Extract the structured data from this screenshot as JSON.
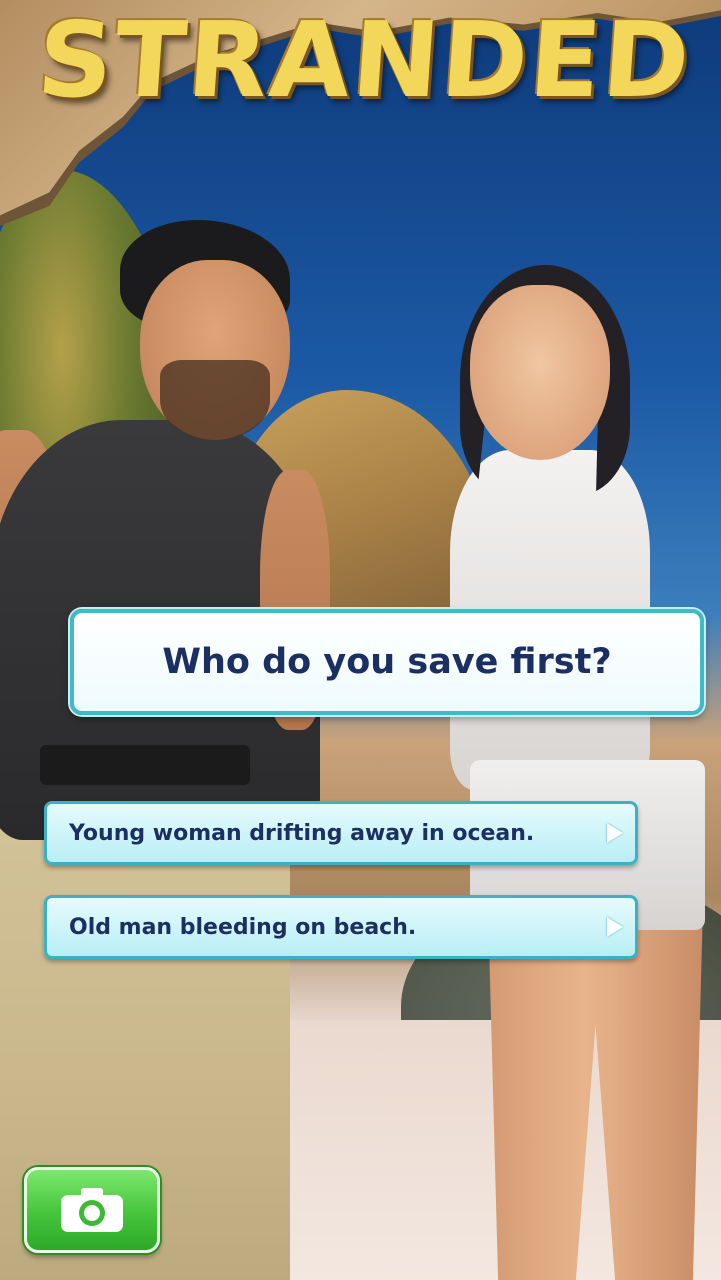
{
  "game": {
    "title": "STRANDED"
  },
  "dialog": {
    "question": "Who do you save first?",
    "choices": [
      {
        "label": "Young woman drifting away in ocean."
      },
      {
        "label": "Old man bleeding on beach."
      }
    ]
  },
  "controls": {
    "camera_icon": "camera-icon",
    "choice_arrow_icon": "play-arrow-icon"
  },
  "colors": {
    "question_text": "#1c2f63",
    "box_border": "#41b9c7",
    "camera_button": "#44c43b",
    "title": "#f2d75a"
  }
}
